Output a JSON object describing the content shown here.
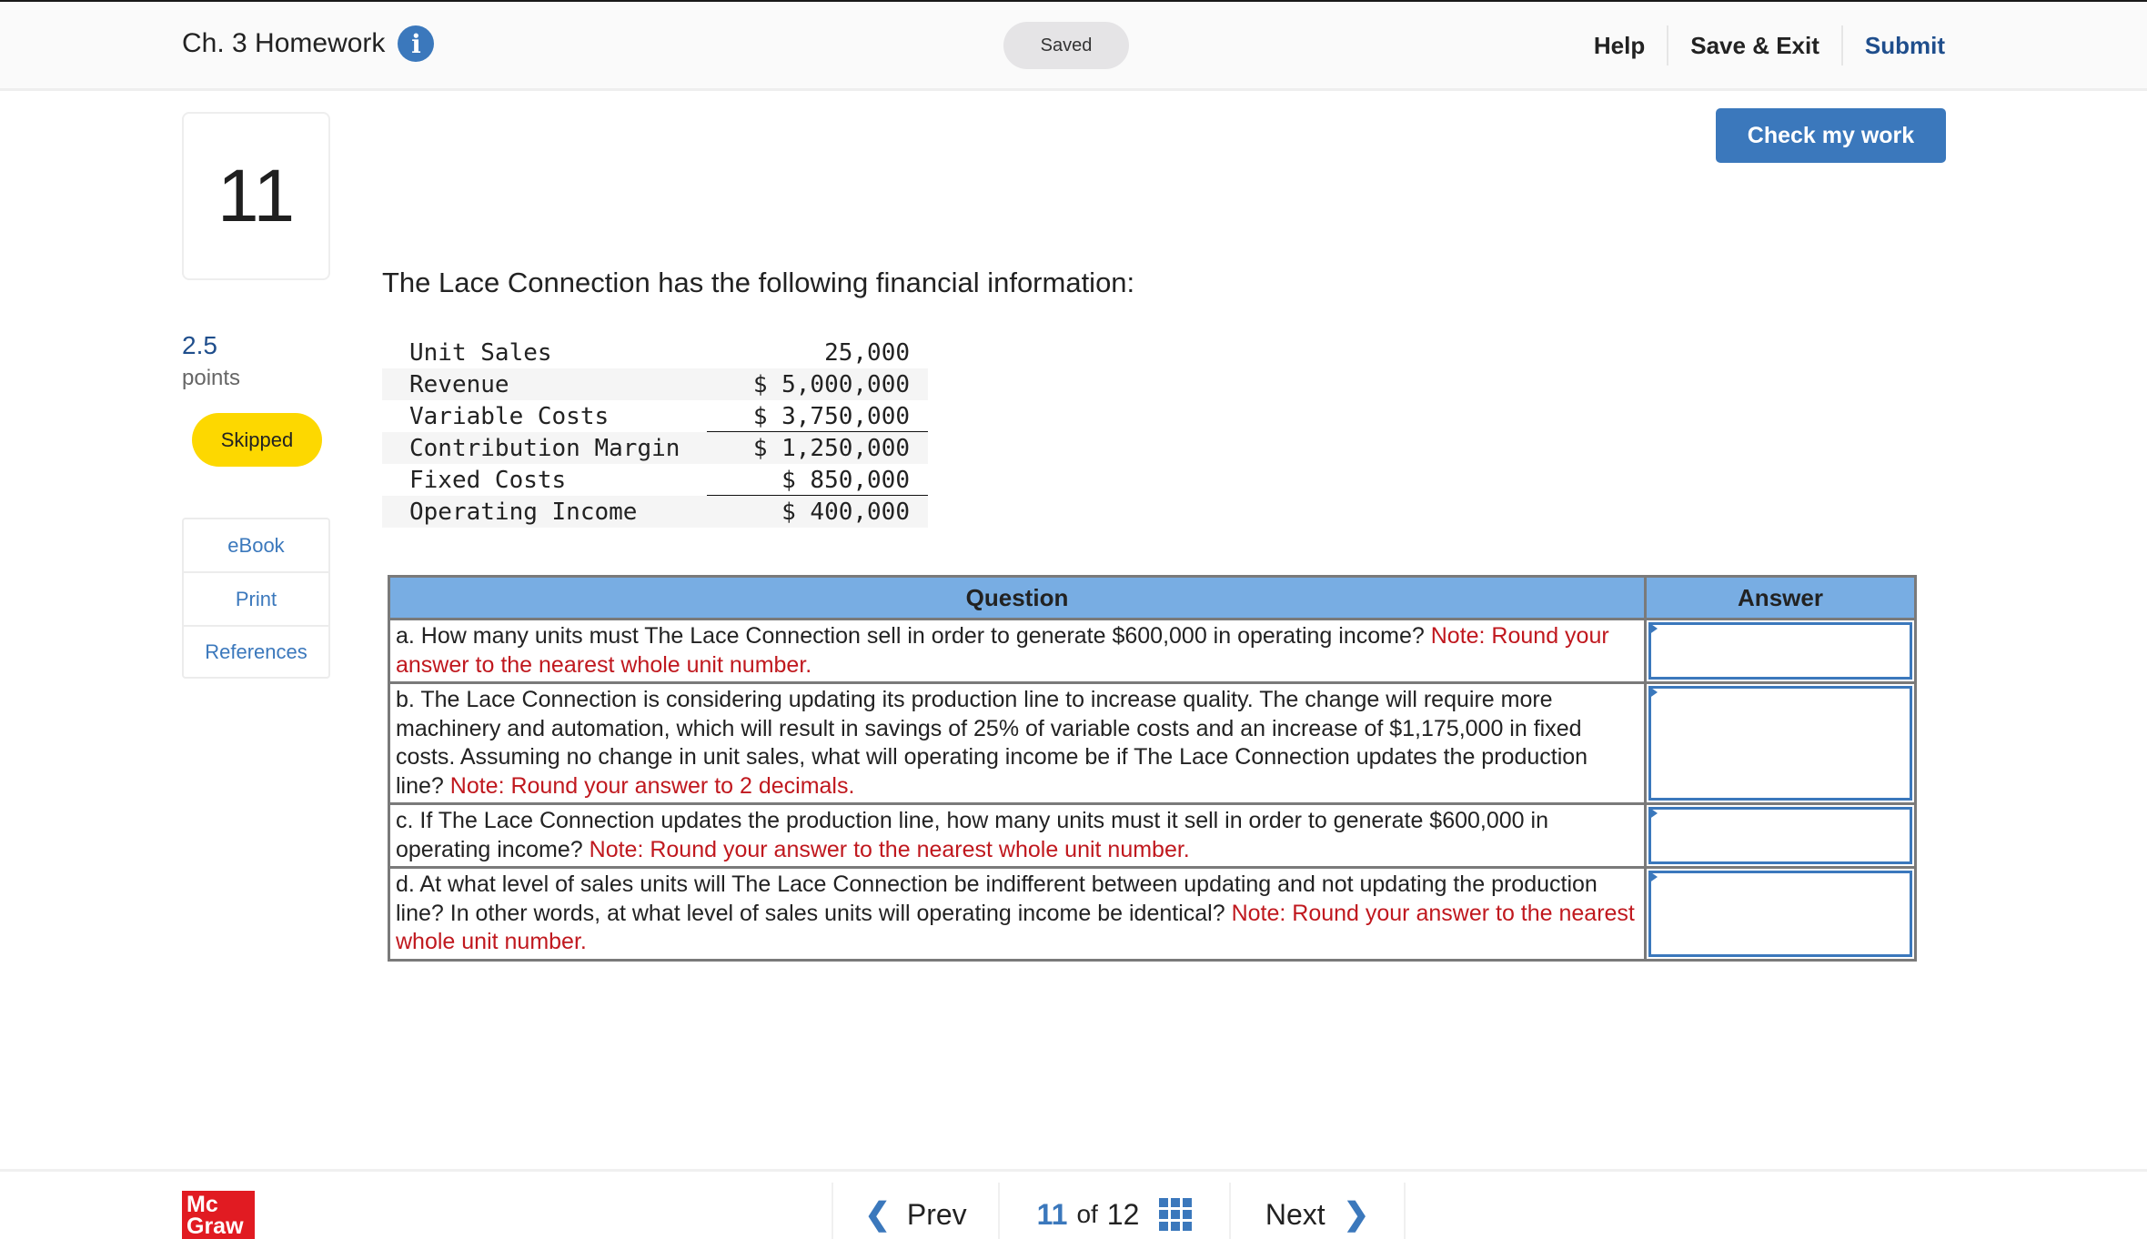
{
  "header": {
    "title": "Ch. 3 Homework",
    "info_icon": "info-icon",
    "save_status": "Saved",
    "links": {
      "help": "Help",
      "save_exit": "Save & Exit",
      "submit": "Submit"
    }
  },
  "check_button": "Check my work",
  "sidebar": {
    "question_number": "11",
    "points_value": "2.5",
    "points_label": "points",
    "status": "Skipped",
    "resources": [
      "eBook",
      "Print",
      "References"
    ]
  },
  "question": {
    "intro": "The Lace Connection has the following financial information:",
    "financials": [
      {
        "label": "Unit Sales",
        "value": "25,000"
      },
      {
        "label": "Revenue",
        "value": "$ 5,000,000"
      },
      {
        "label": "Variable Costs",
        "value": "$ 3,750,000"
      },
      {
        "label": "Contribution Margin",
        "value": "$ 1,250,000"
      },
      {
        "label": "Fixed Costs",
        "value": "$ 850,000"
      },
      {
        "label": "Operating Income",
        "value": "$ 400,000"
      }
    ],
    "table": {
      "headers": {
        "question": "Question",
        "answer": "Answer"
      },
      "rows": [
        {
          "text": "a. How many units must The Lace Connection sell in order to generate $600,000 in operating income? ",
          "note": "Note: Round your answer to the nearest whole unit number.",
          "answer": ""
        },
        {
          "text": "b. The Lace Connection is considering updating its production line to increase quality. The change will require more machinery and automation, which will result in savings of 25% of variable costs and an increase of $1,175,000 in fixed costs. Assuming no change in unit sales, what will operating income be if The Lace Connection updates the production line? ",
          "note": "Note: Round your answer to 2 decimals.",
          "answer": ""
        },
        {
          "text": "c. If The Lace Connection updates the production line, how many units must it sell in order to generate $600,000 in operating income? ",
          "note": "Note: Round your answer to the nearest whole unit number.",
          "answer": ""
        },
        {
          "text": "d. At what level of sales units will The Lace Connection be indifferent between updating and not updating the production line? In other words, at what level of sales units will operating income be identical? ",
          "note": "Note: Round your answer to the nearest whole unit number.",
          "answer": ""
        }
      ]
    }
  },
  "footer": {
    "logo_line1": "Mc",
    "logo_line2": "Graw",
    "prev": "Prev",
    "current": "11",
    "of": "of",
    "total": "12",
    "next": "Next"
  },
  "colors": {
    "accent_blue": "#3b78bc",
    "submit_blue": "#1f4e8c",
    "table_header": "#78ade3",
    "note_red": "#c0181e",
    "skipped_yellow": "#fdd800",
    "logo_red": "#e11b22"
  }
}
